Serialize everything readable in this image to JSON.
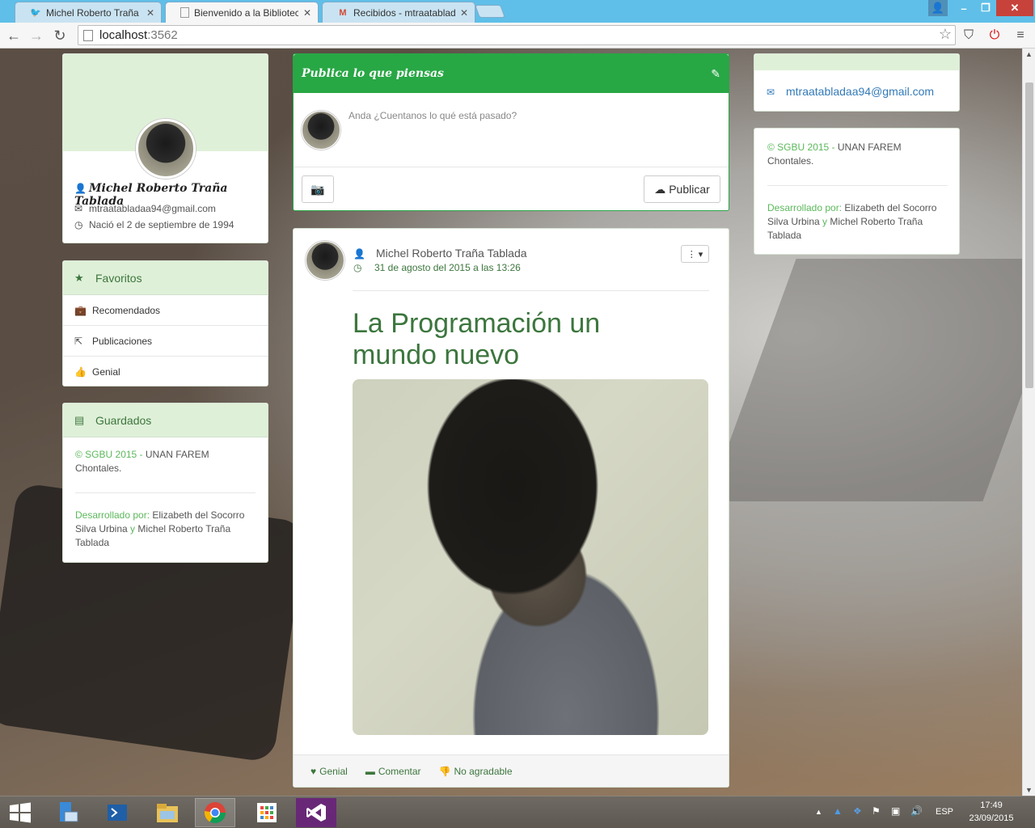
{
  "browser": {
    "tabs": [
      {
        "label": "Michel Roberto Traña (@r",
        "icon": "twitter-icon"
      },
      {
        "label": "Bienvenido a la Biblioteca",
        "icon": "page-icon"
      },
      {
        "label": "Recibidos - mtraatablada",
        "icon": "gmail-icon"
      }
    ],
    "url_host": "localhost",
    "url_port": ":3562"
  },
  "profile": {
    "name": "Michel Roberto Traña Tablada",
    "email": "mtraatabladaa94@gmail.com",
    "birth": "Nació el 2 de septiembre de 1994"
  },
  "favoritos": {
    "title": "Favoritos",
    "items": [
      {
        "label": "Recomendados",
        "icon": "briefcase-icon"
      },
      {
        "label": "Publicaciones",
        "icon": "share-icon"
      },
      {
        "label": "Genial",
        "icon": "thumbs-up-icon"
      }
    ]
  },
  "guardados": {
    "title": "Guardados",
    "copyright_prefix": "© SGBU 2015 -",
    "copyright_rest": "UNAN FAREM Chontales.",
    "dev_label": "Desarrollado por:",
    "dev_name1": "Elizabeth del Socorro Silva Urbina",
    "dev_and": "y",
    "dev_name2": "Michel Roberto Traña Tablada"
  },
  "composer": {
    "title": "Publica lo que piensas",
    "placeholder": "Anda ¿Cuentanos lo qué está pasado?",
    "publish_label": "Publicar"
  },
  "post": {
    "author": "Michel Roberto Traña Tablada",
    "date": "31 de agosto del 2015 a las 13:26",
    "title_line1": "La Programación un",
    "title_line2": "mundo nuevo",
    "actions": [
      {
        "label": "Genial",
        "icon": "heart-icon"
      },
      {
        "label": "Comentar",
        "icon": "comment-icon"
      },
      {
        "label": "No agradable",
        "icon": "thumbs-down-icon"
      }
    ]
  },
  "right": {
    "email": "mtraatabladaa94@gmail.com",
    "copyright_prefix": "© SGBU 2015 -",
    "copyright_rest": "UNAN FAREM Chontales.",
    "dev_label": "Desarrollado por:",
    "dev_name1": "Elizabeth del Socorro Silva Urbina",
    "dev_and": "y",
    "dev_name2": "Michel Roberto Traña Tablada"
  },
  "taskbar": {
    "lang": "ESP",
    "time": "17:49",
    "date": "23/09/2015"
  },
  "colors": {
    "brand_green": "#28a745",
    "header_green_bg": "#dff0d8",
    "text_green": "#3c763d"
  }
}
